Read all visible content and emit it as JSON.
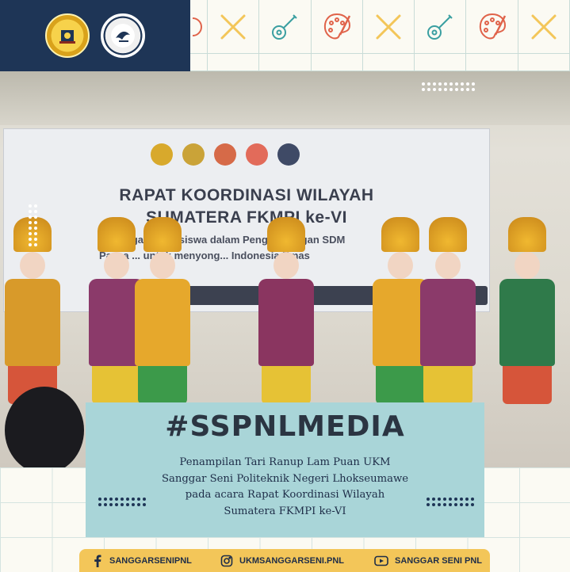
{
  "header": {
    "logos": [
      {
        "name": "politeknik-logo",
        "text": "POLITEKNIK NEGERI LHOKSEUMAWE"
      },
      {
        "name": "ukm-logo",
        "text": "UKM KEGIATAN MAHASISWA"
      }
    ],
    "grid_icons": [
      "palette-icon",
      "cross-icon",
      "guitar-icon",
      "palette-icon",
      "cross-icon",
      "guitar-icon",
      "palette-icon",
      "cross-icon"
    ]
  },
  "photo": {
    "banner_title_line1": "RAPAT KOORDINASI WILAYAH",
    "banner_title_line2": "SUMATERA FKMPI ke-VI",
    "banner_sub_line1": "...gan Mahasiswa dalam Pengembangan SDM",
    "banner_sub_line2": "Pasca ... untuk menyong... Indonesia Emas"
  },
  "caption": {
    "hashtag": "#SSPNLMEDIA",
    "lines": [
      "Penampilan Tari Ranup Lam Puan UKM",
      "Sanggar Seni Politeknik Negeri Lhokseumawe",
      "pada acara Rapat Koordinasi Wilayah",
      "Sumatera FKMPI ke-VI"
    ]
  },
  "footer": {
    "facebook": "SANGGARSENIPNL",
    "instagram": "UKMSANGGARSENI.PNL",
    "youtube": "SANGGAR SENI PNL"
  },
  "colors": {
    "navy": "#1e3556",
    "caption_bg": "#a9d5d8",
    "footer_bg": "#f3c659",
    "accent_red": "#e0634a",
    "accent_yellow": "#f3c659",
    "accent_teal": "#3a9fa1"
  }
}
